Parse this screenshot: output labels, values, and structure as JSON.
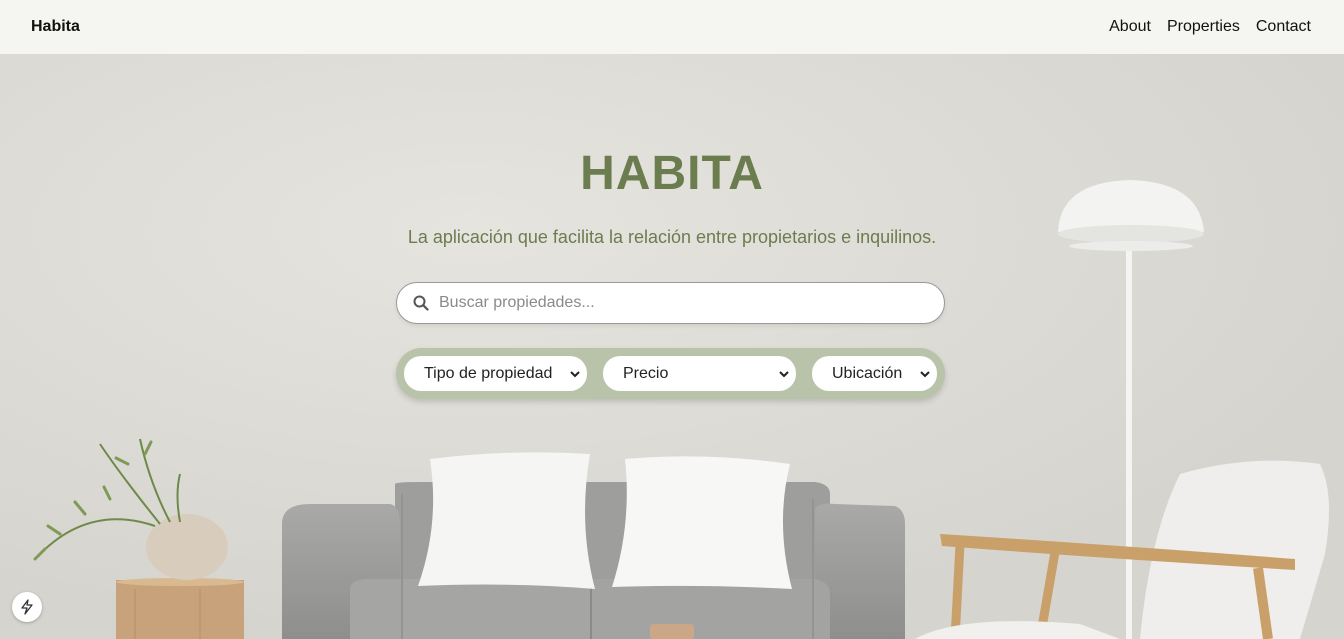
{
  "navbar": {
    "brand": "Habita",
    "links": [
      "About",
      "Properties",
      "Contact"
    ]
  },
  "hero": {
    "title": "HABITA",
    "subtitle": "La aplicación que facilita la relación entre propietarios e inquilinos.",
    "search": {
      "placeholder": "Buscar propiedades...",
      "value": ""
    },
    "filters": [
      {
        "label": "Tipo de propiedad"
      },
      {
        "label": "Precio"
      },
      {
        "label": "Ubicación"
      }
    ]
  },
  "icons": {
    "search": "search-icon",
    "chevron": "chevron-down-icon",
    "dev_badge": "lightning-icon"
  },
  "colors": {
    "accent": "#6b7d4f",
    "filter_bar": "#b9c3aa",
    "navbar_bg": "#f5f5f1"
  }
}
